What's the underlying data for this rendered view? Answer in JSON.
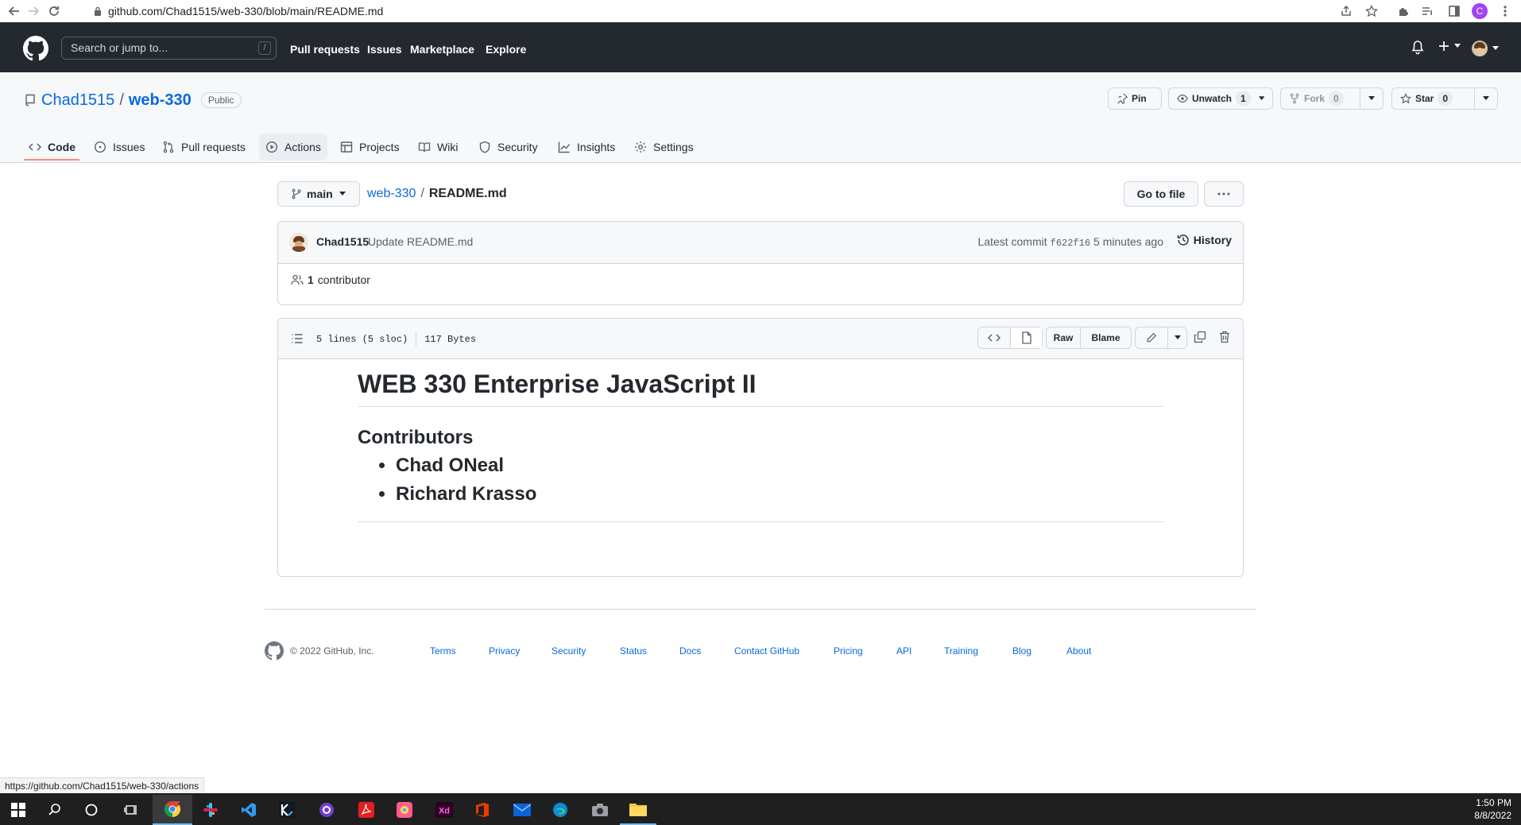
{
  "browser": {
    "url": "github.com/Chad1515/web-330/blob/main/README.md",
    "profile_initial": "C"
  },
  "header": {
    "search_placeholder": "Search or jump to...",
    "search_shortcut": "/",
    "nav": [
      "Pull requests",
      "Issues",
      "Marketplace",
      "Explore"
    ]
  },
  "repo": {
    "owner": "Chad1515",
    "separator": "/",
    "name": "web-330",
    "visibility": "Public",
    "pin_label": "Pin",
    "unwatch_label": "Unwatch",
    "watch_count": "1",
    "fork_label": "Fork",
    "fork_count": "0",
    "star_label": "Star",
    "star_count": "0"
  },
  "tabs": [
    {
      "label": "Code",
      "icon": "code-icon"
    },
    {
      "label": "Issues",
      "icon": "issue-icon"
    },
    {
      "label": "Pull requests",
      "icon": "pull-request-icon"
    },
    {
      "label": "Actions",
      "icon": "play-icon"
    },
    {
      "label": "Projects",
      "icon": "table-icon"
    },
    {
      "label": "Wiki",
      "icon": "book-icon"
    },
    {
      "label": "Security",
      "icon": "shield-icon"
    },
    {
      "label": "Insights",
      "icon": "graph-icon"
    },
    {
      "label": "Settings",
      "icon": "gear-icon"
    }
  ],
  "file": {
    "branch": "main",
    "crumb_repo": "web-330",
    "crumb_sep": "/",
    "crumb_file": "README.md",
    "goto_label": "Go to file",
    "commit_author": "Chad1515",
    "commit_message": "Update README.md",
    "latest_commit_label": "Latest commit",
    "commit_sha": "f622f16",
    "commit_time": "5 minutes ago",
    "history_label": "History",
    "contributor_count": "1",
    "contributor_label": "contributor",
    "lines_info": "5 lines (5 sloc)",
    "size_info": "117 Bytes",
    "raw_label": "Raw",
    "blame_label": "Blame"
  },
  "readme": {
    "title": "WEB 330 Enterprise JavaScript II",
    "section": "Contributors",
    "items": [
      "Chad ONeal",
      "Richard Krasso"
    ]
  },
  "footer": {
    "copyright": "© 2022 GitHub, Inc.",
    "links": [
      "Terms",
      "Privacy",
      "Security",
      "Status",
      "Docs",
      "Contact GitHub",
      "Pricing",
      "API",
      "Training",
      "Blog",
      "About"
    ]
  },
  "status_url": "https://github.com/Chad1515/web-330/actions",
  "clock": {
    "time": "1:50 PM",
    "date": "8/8/2022"
  },
  "colors": {
    "accent": "#0969da",
    "header_bg": "#24292f",
    "tab_underline": "#fd8c73"
  }
}
